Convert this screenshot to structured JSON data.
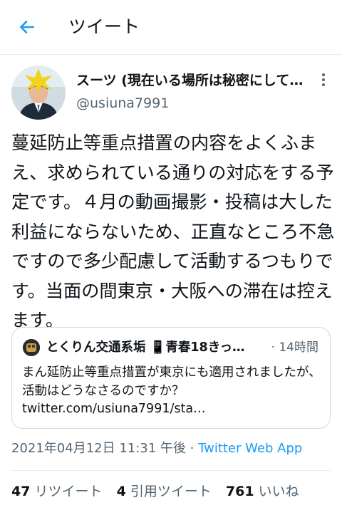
{
  "header": {
    "title": "ツイート",
    "back_icon": "arrow-left-icon",
    "accent": "#1d9bf0"
  },
  "author": {
    "name": "スーツ (現在いる場所は秘密にして…",
    "handle": "@usiuna7991",
    "more_icon": "more-vertical-icon"
  },
  "tweet": {
    "text": "蔓延防止等重点措置の内容をよくふまえ、求められている通りの対応をする予定です。４月の動画撮影・投稿は大した利益にならないため、正直なところ不急ですので多少配慮して活動するつもりです。当面の間東京・大阪への滞在は控えます。"
  },
  "quote": {
    "name": "とくりん交通系垢 📱青春18きっ…",
    "time": "· 14時間",
    "text": "まん延防止等重点措置が東京にも適用されましたが、活動はどうなさるのですか？\ntwitter.com/usiuna7991/sta…"
  },
  "meta": {
    "timestamp": "2021年04月12日 11:31 午後",
    "separator": " · ",
    "app": "Twitter Web App"
  },
  "stats": {
    "retweets_count": "47",
    "retweets_label": "リツイート",
    "quotes_count": "4",
    "quotes_label": "引用ツイート",
    "likes_count": "761",
    "likes_label": "いいね"
  }
}
